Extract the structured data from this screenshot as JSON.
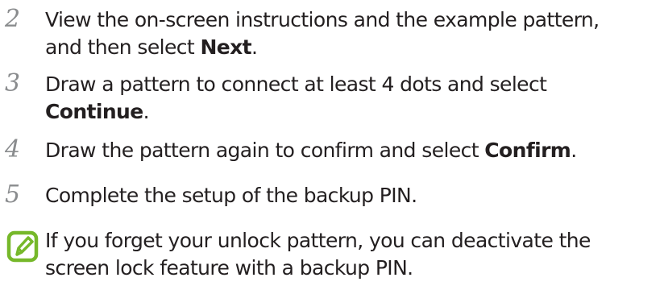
{
  "steps": [
    {
      "number": "2",
      "line1": "View the on-screen instructions and the example pattern,",
      "line2_prefix": "and then select ",
      "line2_bold": "Next",
      "line2_suffix": "."
    },
    {
      "number": "3",
      "line1": "Draw a pattern to connect at least 4 dots and select",
      "line2_bold": "Continue",
      "line2_suffix": "."
    },
    {
      "number": "4",
      "prefix": "Draw the pattern again to confirm and select ",
      "bold": "Confirm",
      "suffix": "."
    },
    {
      "number": "5",
      "text": "Complete the setup of the backup PIN."
    }
  ],
  "note": {
    "icon": "note-pencil-icon",
    "icon_color": "#76b82a",
    "line1": "If you forget your unlock pattern, you can deactivate the",
    "line2": "screen lock feature with a backup PIN."
  }
}
